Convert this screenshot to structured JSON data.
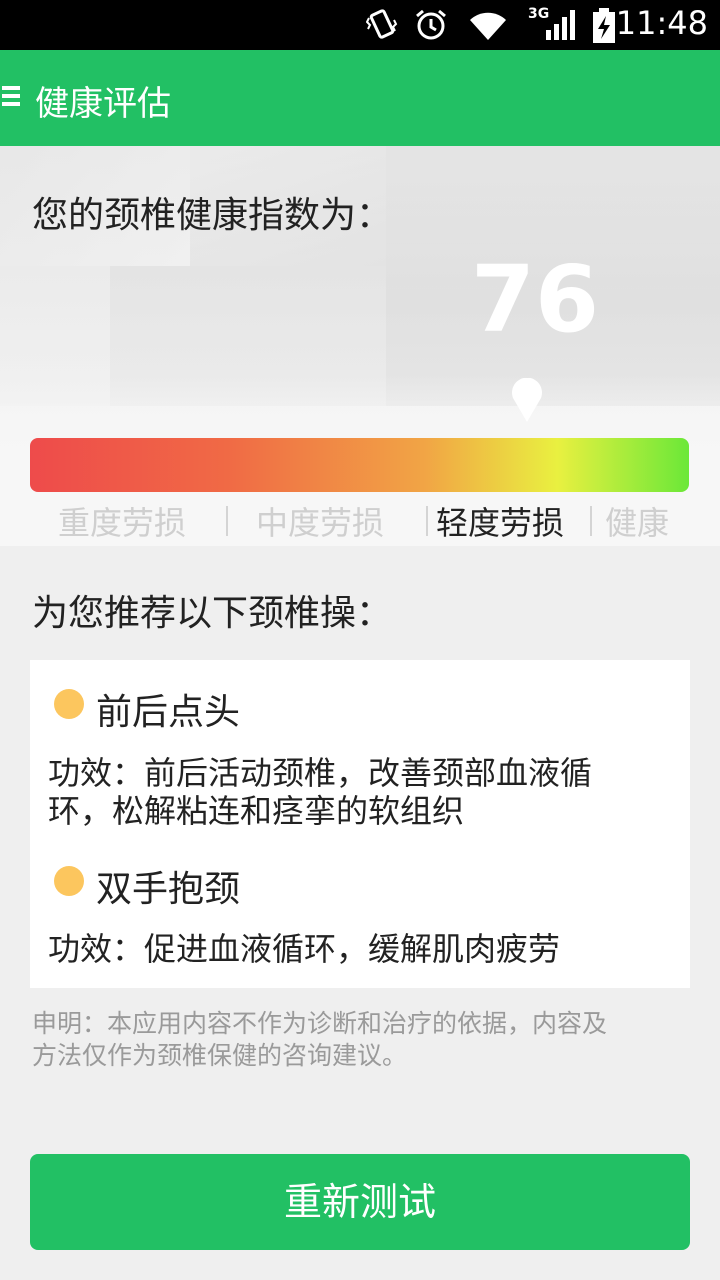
{
  "status_bar": {
    "time": "11:48",
    "network": "3G",
    "icons": [
      "vibrate-icon",
      "alarm-icon",
      "wifi-icon",
      "signal-icon",
      "battery-charging-icon"
    ]
  },
  "app_bar": {
    "menu_icon": "menu-icon",
    "title": "健康评估"
  },
  "result": {
    "heading": "您的颈椎健康指数为：",
    "score": "76",
    "levels": [
      "重度劳损",
      "中度劳损",
      "轻度劳损",
      "健康"
    ],
    "active_level": "轻度劳损",
    "gradient_colors": [
      "#ee4b4b",
      "#f06a45",
      "#f1a545",
      "#e9f040",
      "#6be838"
    ]
  },
  "recommend": {
    "heading": "为您推荐以下颈椎操：",
    "exercises": [
      {
        "title": "前后点头",
        "desc_line1": "功效：前后活动颈椎，改善颈部血液循",
        "desc_line2": "环，松解粘连和痉挛的软组织"
      },
      {
        "title": "双手抱颈",
        "desc_line1": "功效：促进血液循环，缓解肌肉疲劳",
        "desc_line2": ""
      }
    ],
    "bullet_color": "#fcc65e"
  },
  "disclaimer_line1": "申明：本应用内容不作为诊断和治疗的依据，内容及",
  "disclaimer_line2": "方法仅作为颈椎保健的咨询建议。",
  "retest_label": "重新测试",
  "colors": {
    "brand_green": "#22c064",
    "status_bar": "#000000"
  }
}
